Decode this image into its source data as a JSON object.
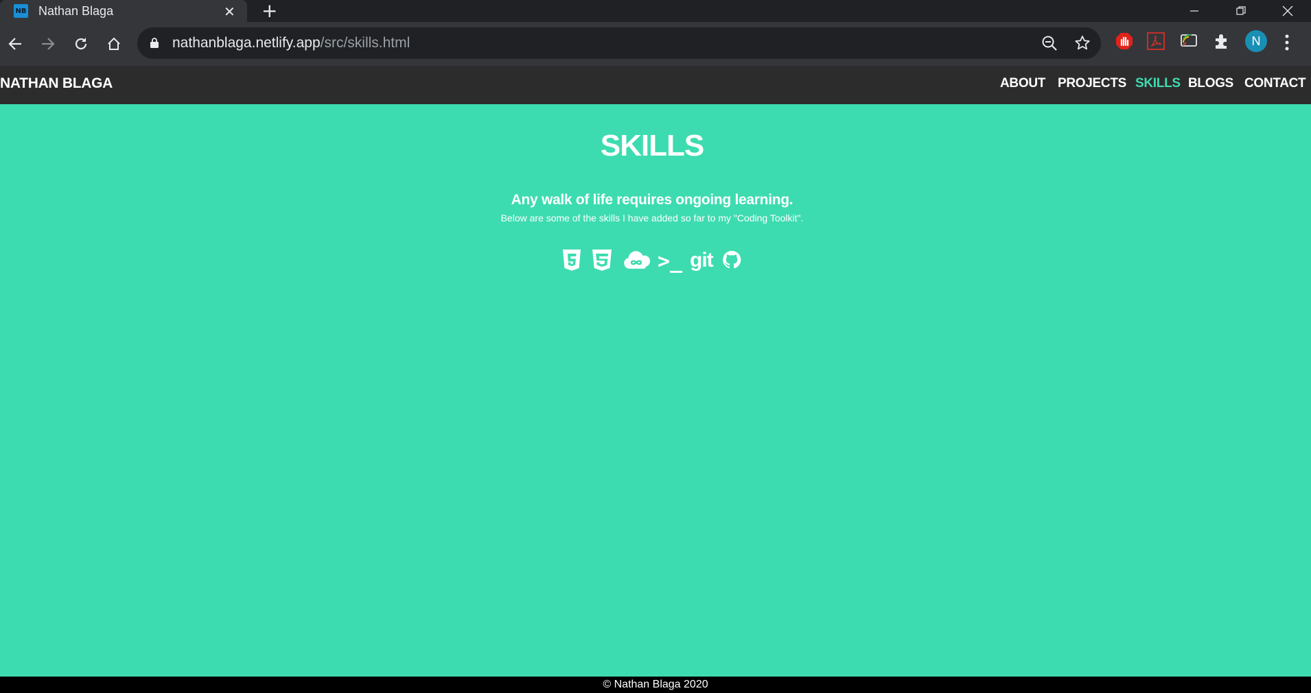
{
  "browser": {
    "tab_title": "Nathan Blaga",
    "favicon_text": "NB",
    "url_host": "nathanblaga.netlify.app",
    "url_path": "/src/skills.html",
    "profile_initial": "N"
  },
  "site": {
    "brand": "NATHAN BLAGA",
    "nav": [
      {
        "label": "ABOUT",
        "active": false
      },
      {
        "label": "PROJECTS",
        "active": false
      },
      {
        "label": "SKILLS",
        "active": true
      },
      {
        "label": "BLOGS",
        "active": false
      },
      {
        "label": "CONTACT",
        "active": false
      }
    ]
  },
  "main": {
    "title": "SKILLS",
    "subtitle": "Any walk of life requires ongoing learning.",
    "description": "Below are some of the skills I have added so far to my \"Coding Toolkit\".",
    "skills": [
      "html5-icon",
      "css3-icon",
      "cloud-infinity-icon",
      "terminal-icon",
      "git-icon",
      "github-icon"
    ],
    "terminal_glyph": ">_",
    "git_text": "git"
  },
  "footer": {
    "text": "© Nathan Blaga 2020"
  },
  "colors": {
    "accent": "#3ddcb0",
    "nav_bg": "#2d2c2c",
    "footer_bg": "#000000"
  }
}
